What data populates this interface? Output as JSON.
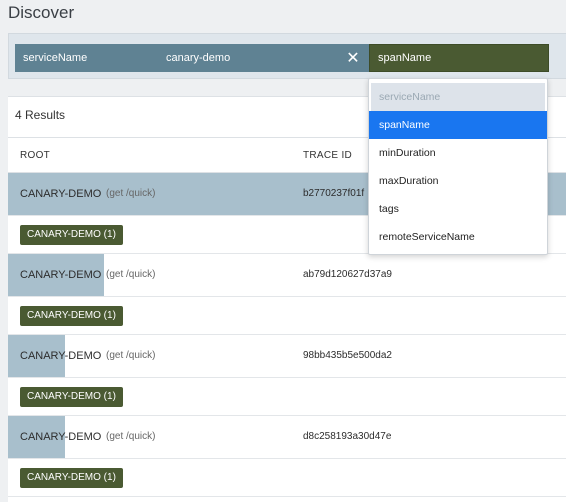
{
  "page": {
    "title": "Discover"
  },
  "search": {
    "service_chip": {
      "key": "serviceName",
      "value": "canary-demo",
      "close_glyph": "✕"
    },
    "span_chip": {
      "key": "spanName"
    }
  },
  "dropdown": {
    "items": [
      {
        "label": "serviceName",
        "state": "disabled"
      },
      {
        "label": "spanName",
        "state": "selected"
      },
      {
        "label": "minDuration",
        "state": "normal"
      },
      {
        "label": "maxDuration",
        "state": "normal"
      },
      {
        "label": "tags",
        "state": "normal"
      },
      {
        "label": "remoteServiceName",
        "state": "normal"
      }
    ]
  },
  "results": {
    "count_label": "4 Results",
    "columns": {
      "root": "ROOT",
      "trace_id": "TRACE ID"
    },
    "traces": [
      {
        "name": "CANARY-DEMO",
        "path": "(get /quick)",
        "trace_id": "b2770237f01f",
        "duration_fraction": 1.0,
        "badge": "CANARY-DEMO (1)"
      },
      {
        "name": "CANARY-DEMO",
        "path": "(get /quick)",
        "trace_id": "ab79d120627d37a9",
        "duration_fraction": 0.17,
        "badge": "CANARY-DEMO (1)"
      },
      {
        "name": "CANARY-DEMO",
        "path": "(get /quick)",
        "trace_id": "98bb435b5e500da2",
        "duration_fraction": 0.1,
        "badge": "CANARY-DEMO (1)"
      },
      {
        "name": "CANARY-DEMO",
        "path": "(get /quick)",
        "trace_id": "d8c258193a30d47e",
        "duration_fraction": 0.1,
        "badge": "CANARY-DEMO (1)"
      }
    ]
  },
  "colors": {
    "chip_service": "#5f8293",
    "chip_span": "#4a5a32",
    "bar": "#a8bfcc",
    "selected_item": "#1976f0"
  }
}
